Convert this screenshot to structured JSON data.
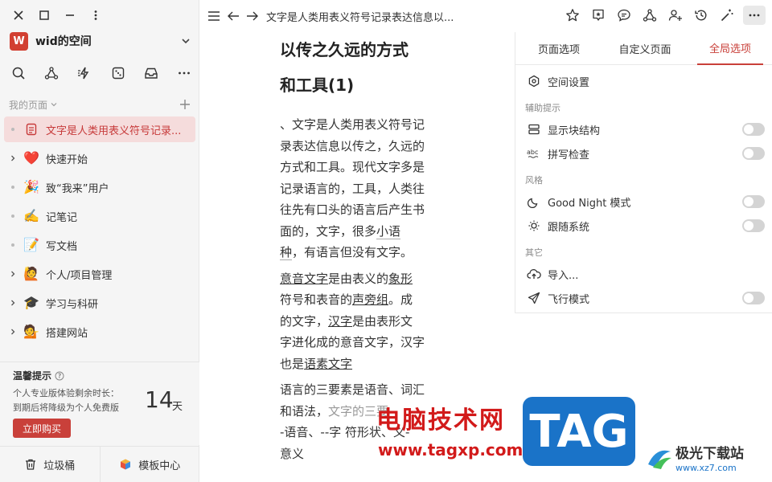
{
  "workspace": {
    "avatar_letter": "W",
    "name": "wid的空间"
  },
  "sidebar": {
    "section_label": "我的页面",
    "items": [
      {
        "label": "文字是人类用表义符号记录...",
        "emoji": "",
        "expandable": false,
        "active": true
      },
      {
        "label": "快速开始",
        "emoji": "❤️",
        "expandable": true,
        "active": false
      },
      {
        "label": "致“我来”用户",
        "emoji": "🎉",
        "expandable": false,
        "active": false
      },
      {
        "label": "记笔记",
        "emoji": "✍️",
        "expandable": false,
        "active": false
      },
      {
        "label": "写文档",
        "emoji": "📝",
        "expandable": false,
        "active": false
      },
      {
        "label": "个人/项目管理",
        "emoji": "🙋",
        "expandable": true,
        "active": false
      },
      {
        "label": "学习与科研",
        "emoji": "🎓",
        "expandable": true,
        "active": false
      },
      {
        "label": "搭建网站",
        "emoji": "💁",
        "expandable": true,
        "active": false
      }
    ]
  },
  "tip": {
    "title": "温馨提示",
    "line1": "个人专业版体验剩余时长：",
    "line2": "到期后将降级为个人免费版",
    "days": "14",
    "days_unit": "天",
    "buy_label": "立即购买"
  },
  "bottom": {
    "trash_label": "垃圾桶",
    "template_label": "模板中心"
  },
  "topbar": {
    "title": "文字是人类用表义符号记录表达信息以..."
  },
  "doc": {
    "heading_line1": "以传之久远的方式",
    "heading_line2": "和工具(1)",
    "p1": "、文字是人类用表义符号记录表达信息以传之，久远的方式和工具。现代文字多是记录语言的，工具，人类往往先有口头的语言后产生书面的，文字，很多",
    "p1_link": "小语种",
    "p1_tail": "，有语言但没有文字。",
    "p2_a": "意音文字",
    "p2_b": "是由表义的",
    "p2_c": "象形",
    "p2_d": "符号和表音的",
    "p2_e": "声旁组",
    "p2_f": "。成的文字，",
    "p2_g": "汉字",
    "p2_h": "是由表形文字进化成的意音文字，汉字也是",
    "p2_i": "语素文字",
    "p3_a": "语言的三要素是语音、词汇和语法，",
    "p3_b": "文字的三要",
    "p3_c": "-语音、--字 符形状、义-",
    "p3_d": "意义"
  },
  "panel": {
    "tabs": [
      "页面选项",
      "自定义页面",
      "全局选项"
    ],
    "active_tab": 2,
    "space_settings": "空间设置",
    "section_assist": "辅助提示",
    "show_blocks": "显示块结构",
    "spellcheck": "拼写检查",
    "section_style": "风格",
    "good_night": "Good Night 模式",
    "follow_system": "跟随系统",
    "section_other": "其它",
    "import": "导入...",
    "airplane": "飞行模式"
  },
  "watermark": {
    "cn_text": "电脑技术网",
    "url": "www.tagxp.com",
    "tag": "TAG",
    "xz_name": "极光下载站",
    "xz_url": "www.xz7.com"
  }
}
